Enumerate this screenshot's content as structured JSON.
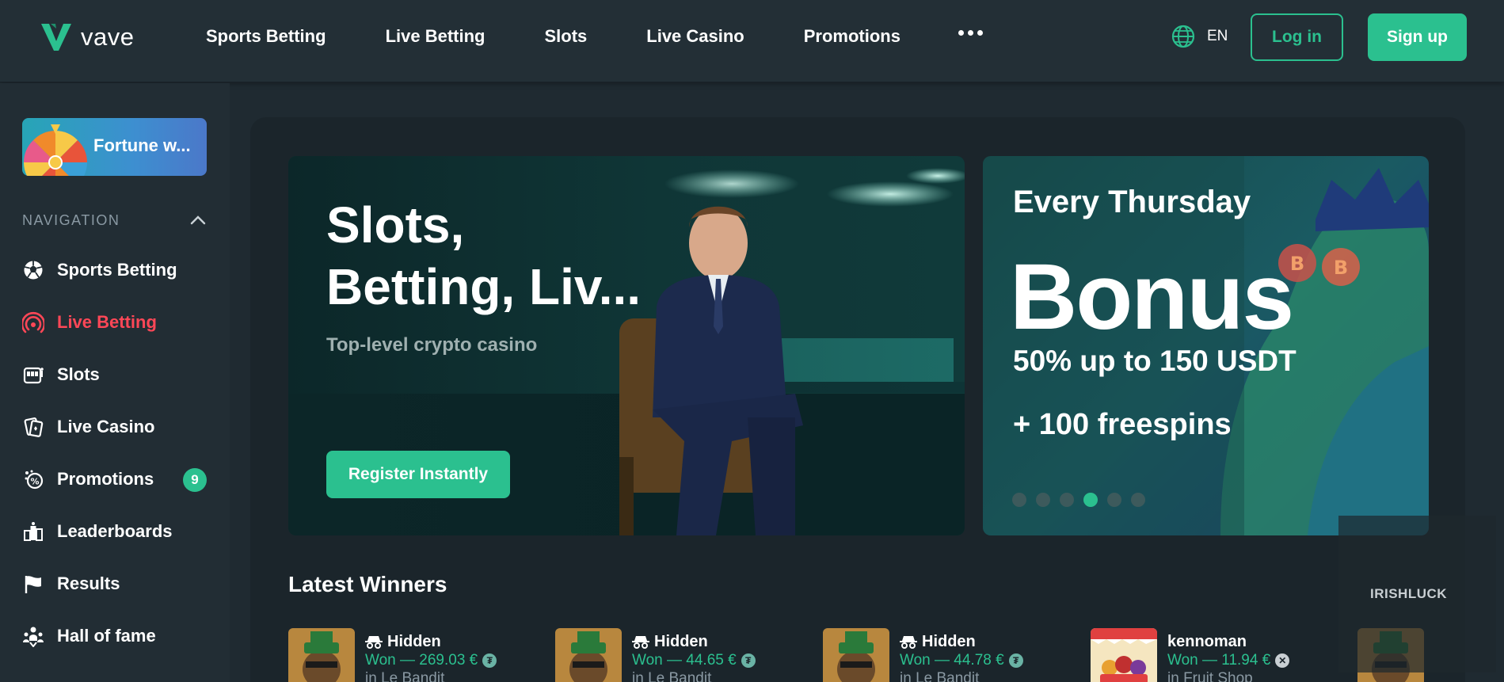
{
  "header": {
    "logo_text": "vave",
    "nav": [
      {
        "label": "Sports Betting"
      },
      {
        "label": "Live Betting"
      },
      {
        "label": "Slots"
      },
      {
        "label": "Live Casino"
      },
      {
        "label": "Promotions"
      }
    ],
    "more_icon": "ellipsis-icon",
    "language": "EN",
    "login_label": "Log in",
    "signup_label": "Sign up"
  },
  "sidebar": {
    "fortune_label": "Fortune w...",
    "nav_heading": "NAVIGATION",
    "items": [
      {
        "label": "Sports Betting",
        "icon": "soccer-ball-icon"
      },
      {
        "label": "Live Betting",
        "icon": "live-signal-icon",
        "active": true
      },
      {
        "label": "Slots",
        "icon": "slot-machine-icon"
      },
      {
        "label": "Live Casino",
        "icon": "cards-icon"
      },
      {
        "label": "Promotions",
        "icon": "promo-icon",
        "badge": "9"
      },
      {
        "label": "Leaderboards",
        "icon": "leaderboard-icon"
      },
      {
        "label": "Results",
        "icon": "flag-icon"
      },
      {
        "label": "Hall of fame",
        "icon": "trophy-people-icon"
      }
    ]
  },
  "hero": {
    "title": "Slots,\nBetting, Liv...",
    "subtitle": "Top-level crypto casino",
    "button_label": "Register Instantly"
  },
  "promo": {
    "kicker": "Every Thursday",
    "headline": "Bonus",
    "line1": "50% up to 150 USDT",
    "line2": "+ 100 freespins",
    "slides": 6,
    "active_slide": 4
  },
  "latest_winners": {
    "title": "Latest Winners",
    "items": [
      {
        "name": "Hidden",
        "won": "Won — 269.03 €",
        "game": "in Le Bandit",
        "currency": "USDT"
      },
      {
        "name": "Hidden",
        "won": "Won — 44.65 €",
        "game": "in Le Bandit",
        "currency": "USDT"
      },
      {
        "name": "Hidden",
        "won": "Won — 44.78 €",
        "game": "in Le Bandit",
        "currency": "USDT"
      },
      {
        "name": "kennoman",
        "won": "Won — 11.94 €",
        "game": "in Fruit Shop",
        "currency": "XRP"
      }
    ]
  },
  "watermark": "IRISHLUCK",
  "colors": {
    "accent": "#2bc08f",
    "active_nav": "#ff4757",
    "background": "#1f2a31",
    "panel": "#1b252b"
  }
}
